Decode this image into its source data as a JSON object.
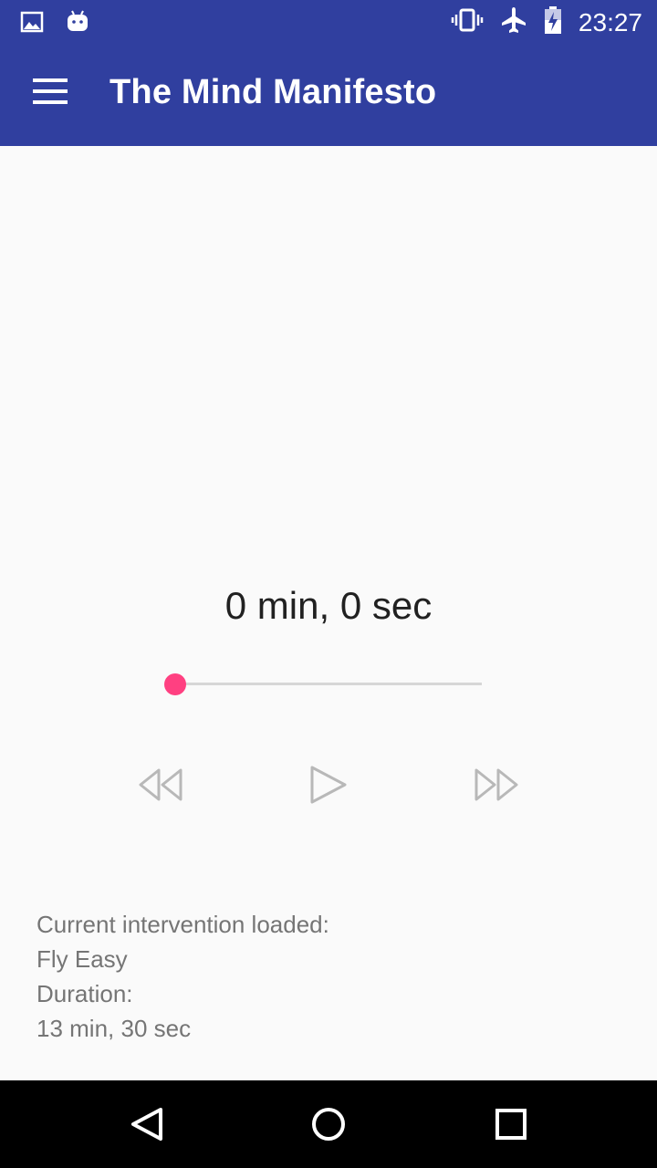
{
  "status_bar": {
    "time": "23:27",
    "icons": [
      "image-icon",
      "android-icon",
      "vibrate-icon",
      "airplane-mode-icon",
      "battery-charging-icon"
    ]
  },
  "app_bar": {
    "title": "The Mind Manifesto",
    "menu_icon": "hamburger-menu-icon"
  },
  "player": {
    "elapsed": "0 min, 0 sec",
    "progress": 0,
    "controls": [
      "rewind-icon",
      "play-icon",
      "fast-forward-icon"
    ]
  },
  "intervention": {
    "loaded_label": "Current intervention loaded:",
    "name": "Fly Easy",
    "duration_label": "Duration:",
    "duration": "13 min, 30 sec"
  },
  "colors": {
    "primary": "#303f9f",
    "accent": "#ff4081",
    "background": "#fafafa"
  },
  "nav_bar": {
    "buttons": [
      "back-icon",
      "home-icon",
      "recents-icon"
    ]
  }
}
